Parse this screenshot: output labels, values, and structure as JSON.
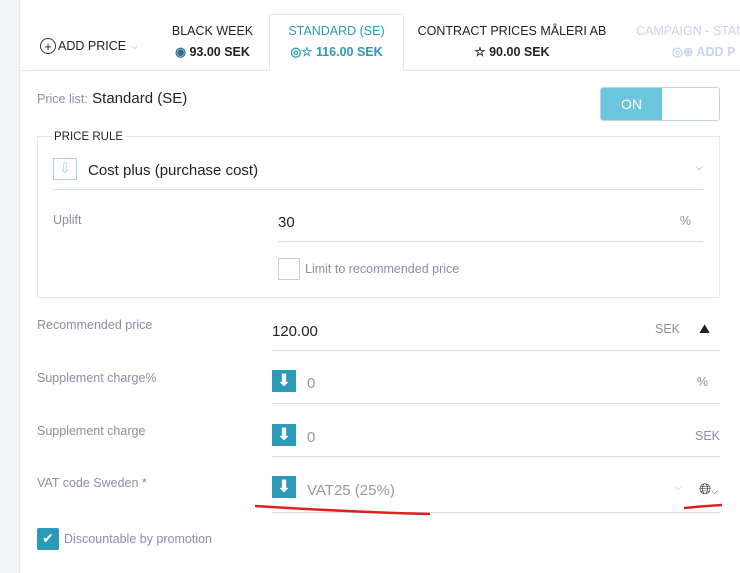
{
  "tabs": {
    "add_price": "ADD PRICE",
    "items": [
      {
        "title": "BLACK WEEK",
        "price": "93.00 SEK"
      },
      {
        "title": "STANDARD (SE)",
        "price": "116.00 SEK"
      },
      {
        "title": "CONTRACT PRICES MÅLERI AB",
        "price": "90.00 SEK"
      },
      {
        "title": "CAMPAIGN - STAN",
        "price": "ADD P"
      }
    ]
  },
  "price_list": {
    "label": "Price list:",
    "value": "Standard (SE)",
    "toggle": "ON"
  },
  "price_rule": {
    "heading": "PRICE RULE",
    "selected": "Cost plus (purchase cost)",
    "uplift_label": "Uplift",
    "uplift_value": "30",
    "uplift_unit": "%",
    "limit_label": "Limit to recommended price"
  },
  "fields": {
    "recommended": {
      "label": "Recommended price",
      "value": "120.00",
      "unit": "SEK"
    },
    "supp_pct": {
      "label": "Supplement charge%",
      "value": "0",
      "unit": "%"
    },
    "supp": {
      "label": "Supplement charge",
      "value": "0",
      "unit": "SEK"
    },
    "vat": {
      "label": "VAT code Sweden *",
      "value": "VAT25 (25%)"
    }
  },
  "discountable": {
    "label": "Discountable by promotion",
    "checked": true
  },
  "colors": {
    "accent": "#2b9ab9",
    "toggle_on": "#6cc5dc",
    "annotation": "#e02020"
  }
}
